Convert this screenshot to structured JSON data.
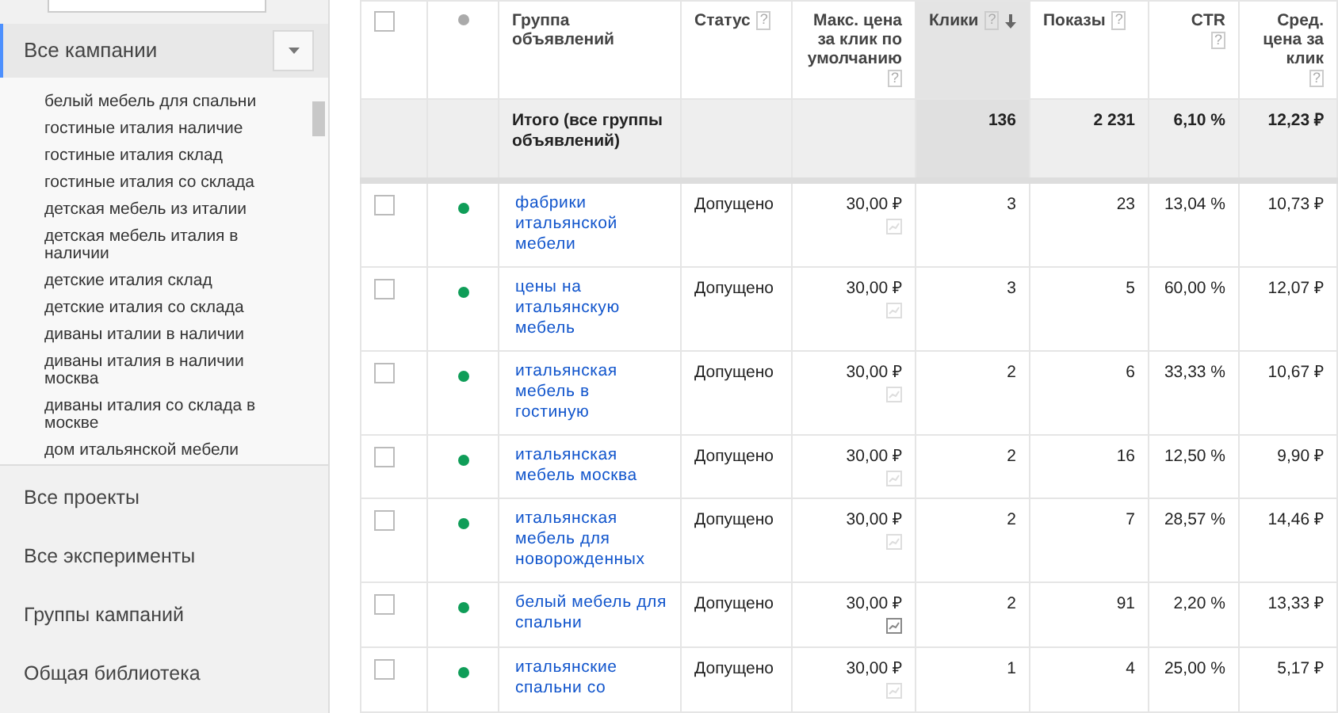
{
  "sidebar": {
    "campaign_selector": {
      "label": "Все кампании"
    },
    "campaigns": [
      "белый мебель для спальни",
      "гостиные италия наличие",
      "гостиные италия склад",
      "гостиные италия со склада",
      "детская мебель из италии",
      "детская мебель италия в наличии",
      "детские италия склад",
      "детские италия со склада",
      "диваны италии в наличии",
      "диваны италия в наличии москва",
      "диваны италия со склада в москве",
      "дом итальянской мебели"
    ],
    "nav": [
      "Все проекты",
      "Все эксперименты",
      "Группы кампаний",
      "Общая библиотека"
    ]
  },
  "table": {
    "columns": [
      {
        "kind": "checkbox",
        "checked": false
      },
      {
        "kind": "status_dot"
      },
      {
        "kind": "text",
        "label": "Группа объявлений",
        "align_right": false
      },
      {
        "kind": "text",
        "label": "Статус",
        "help": "?",
        "align_right": false
      },
      {
        "kind": "text",
        "label": "Макс. цена за клик по умолчанию",
        "help": "?",
        "align_right": true
      },
      {
        "kind": "text",
        "label": "Клики",
        "help": "?",
        "align_right": false,
        "sorted": true
      },
      {
        "kind": "text",
        "label": "Показы",
        "help": "?",
        "align_right": false
      },
      {
        "kind": "text",
        "label": "CTR",
        "help": "?",
        "align_right": true
      },
      {
        "kind": "text",
        "label": "Сред. цена за клик",
        "help": "?",
        "align_right": true
      }
    ],
    "totals": {
      "label": "Итого (все группы объявлений)",
      "clicks": "136",
      "impressions": "2 231",
      "ctr": "6,10 %",
      "avg_cpc": "12,23 ₽"
    },
    "rows": [
      {
        "checked": false,
        "enabled": true,
        "name": "фабрики итальянской мебели",
        "status": "Допущено",
        "max_cpc": "30,00 ₽",
        "simulator_active": false,
        "clicks": "3",
        "impressions": "23",
        "ctr": "13,04 %",
        "avg_cpc": "10,73 ₽"
      },
      {
        "checked": false,
        "enabled": true,
        "name": "цены на итальянскую мебель",
        "status": "Допущено",
        "max_cpc": "30,00 ₽",
        "simulator_active": false,
        "clicks": "3",
        "impressions": "5",
        "ctr": "60,00 %",
        "avg_cpc": "12,07 ₽"
      },
      {
        "checked": false,
        "enabled": true,
        "name": "итальянская мебель в гостиную",
        "status": "Допущено",
        "max_cpc": "30,00 ₽",
        "simulator_active": false,
        "clicks": "2",
        "impressions": "6",
        "ctr": "33,33 %",
        "avg_cpc": "10,67 ₽"
      },
      {
        "checked": false,
        "enabled": true,
        "name": "итальянская мебель москва",
        "status": "Допущено",
        "max_cpc": "30,00 ₽",
        "simulator_active": false,
        "clicks": "2",
        "impressions": "16",
        "ctr": "12,50 %",
        "avg_cpc": "9,90 ₽"
      },
      {
        "checked": false,
        "enabled": true,
        "name": "итальянская мебель для новорожденных",
        "status": "Допущено",
        "max_cpc": "30,00 ₽",
        "simulator_active": false,
        "clicks": "2",
        "impressions": "7",
        "ctr": "28,57 %",
        "avg_cpc": "14,46 ₽"
      },
      {
        "checked": false,
        "enabled": true,
        "name": "белый мебель для спальни",
        "status": "Допущено",
        "max_cpc": "30,00 ₽",
        "simulator_active": true,
        "clicks": "2",
        "impressions": "91",
        "ctr": "2,20 %",
        "avg_cpc": "13,33 ₽"
      },
      {
        "checked": false,
        "enabled": true,
        "name": "итальянские спальни со",
        "status": "Допущено",
        "max_cpc": "30,00 ₽",
        "simulator_active": false,
        "clicks": "1",
        "impressions": "4",
        "ctr": "25,00 %",
        "avg_cpc": "5,17 ₽"
      }
    ]
  }
}
